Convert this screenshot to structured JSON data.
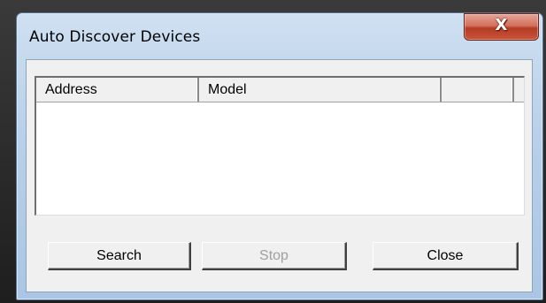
{
  "window": {
    "title": "Auto Discover Devices",
    "close_glyph": "X"
  },
  "list": {
    "columns": [
      "Address",
      "Model",
      ""
    ],
    "rows": []
  },
  "buttons": {
    "search_label": "Search",
    "stop_label": "Stop",
    "stop_enabled": false,
    "close_label": "Close"
  },
  "icons": {
    "close": "close-icon"
  },
  "colors": {
    "title_bar": "#b9d1ea",
    "close_button": "#c8553a",
    "dialog_face": "#f0f0f0",
    "disabled_text": "#a0a0a0"
  }
}
